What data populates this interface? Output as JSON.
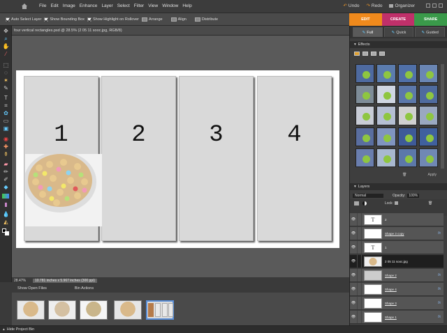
{
  "menubar": {
    "menus": [
      "File",
      "Edit",
      "Image",
      "Enhance",
      "Layer",
      "Select",
      "Filter",
      "View",
      "Window",
      "Help"
    ],
    "undo": "Undo",
    "redo": "Redo",
    "organizer": "Organizer"
  },
  "options": {
    "auto_select": "Auto Select Layer",
    "bounding_box": "Show Bounding Box",
    "highlight": "Show Highlight on Rollover",
    "arrange": "Arrange",
    "align": "Align",
    "distribute": "Distribute"
  },
  "modes": [
    {
      "label": "EDIT",
      "color": "#f08a1c"
    },
    {
      "label": "CREATE",
      "color": "#c0306a"
    },
    {
      "label": "SHARE",
      "color": "#3a9a4a"
    }
  ],
  "document": {
    "tab_title": "four vertical rectangles.psd @ 28.5% (2 05 11 sooc.jpg, RGB/8)",
    "rect_numbers": [
      "1",
      "2",
      "3",
      "4"
    ]
  },
  "status": {
    "zoom": "28.47%",
    "info": "10.781 inches x 5.967 inches (300 ppi)"
  },
  "bin": {
    "show_open_files": "Show Open Files",
    "bin_actions": "Bin Actions",
    "hide_project_bin": "Hide Project Bin"
  },
  "panel": {
    "tabs": [
      "Full",
      "Quick",
      "Guided"
    ],
    "effects_title": "Effects",
    "apply": "Apply",
    "layers_title": "Layers",
    "blend_mode": "Normal",
    "opacity_label": "Opacity:",
    "opacity_value": "100%",
    "lock_label": "Lock:",
    "layers": [
      {
        "name": "2",
        "type": "text",
        "fx": ""
      },
      {
        "name": "Shape 3 copy",
        "type": "shape",
        "fx": "fx"
      },
      {
        "name": "1",
        "type": "text",
        "fx": ""
      },
      {
        "name": "2 05 11 sooc.jpg",
        "type": "photo",
        "fx": "",
        "selected": true
      },
      {
        "name": "Shape 2",
        "type": "shape",
        "fx": "fx"
      },
      {
        "name": "Shape 4",
        "type": "shape",
        "fx": "fx"
      },
      {
        "name": "Shape 3",
        "type": "shape",
        "fx": "fx"
      },
      {
        "name": "Shape 1",
        "type": "shape",
        "fx": "fx"
      }
    ]
  }
}
